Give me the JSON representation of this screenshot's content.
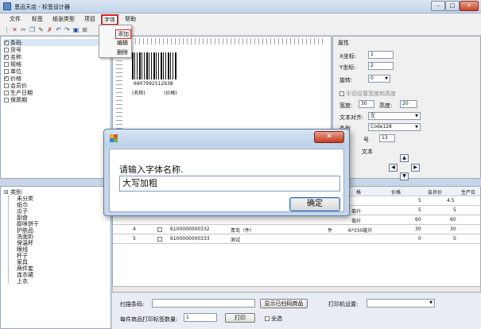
{
  "window": {
    "title": "恩迅天店 - 标签设计器"
  },
  "menu": [
    "文件",
    "标签",
    "纸张类型",
    "项目",
    "字体",
    "帮助"
  ],
  "font_menu": {
    "items": [
      "添加",
      "编辑",
      "删除"
    ]
  },
  "fields": [
    {
      "label": "条码",
      "checked": true
    },
    {
      "label": "货号",
      "checked": false
    },
    {
      "label": "名称",
      "checked": true
    },
    {
      "label": "规格",
      "checked": false
    },
    {
      "label": "单位",
      "checked": false
    },
    {
      "label": "价格",
      "checked": true
    },
    {
      "label": "会员价",
      "checked": false
    },
    {
      "label": "生产日期",
      "checked": false
    },
    {
      "label": "保质期",
      "checked": false
    }
  ],
  "label_preview": {
    "barcode_number": "6907992512938",
    "left_text": "(名称)",
    "right_text": "(价格)"
  },
  "properties": {
    "title": "属性",
    "x_label": "X坐标:",
    "x_value": "1",
    "y_label": "Y坐标:",
    "y_value": "2",
    "rotate_label": "旋转:",
    "rotate_value": "0",
    "manual_size_label": "手动设置宽度和高度",
    "width_label": "宽度:",
    "width_value": "30",
    "height_label": "高度:",
    "height_value": "20",
    "align_label": "文本对齐:",
    "align_value": "左",
    "type_label": "条型",
    "type_value": "Code128",
    "size_label": "号",
    "size_value": "13",
    "text_label": "文本"
  },
  "categories": {
    "root": "类别",
    "items": [
      "未分类",
      "纸巾",
      "瓜子",
      "副食",
      "膨咪饼干",
      "护肤品",
      "洗面奶",
      "保温杯",
      "眼线",
      "杯子",
      "家具",
      "两件套",
      "连衣裙",
      "上衣"
    ]
  },
  "table": {
    "headers": [
      "格",
      "价格",
      "会员价",
      "生产日"
    ],
    "rows": [
      {
        "no": "",
        "code": "",
        "name": "",
        "unit": "",
        "spec": "",
        "price": "5",
        "member": "4.5"
      },
      {
        "no": "",
        "code": "",
        "name": "",
        "unit": "",
        "spec": "毫升",
        "price": "5",
        "member": "5"
      },
      {
        "no": "",
        "code": "",
        "name": "",
        "unit": "",
        "spec": "毫升",
        "price": "60",
        "member": "60"
      },
      {
        "no": "4",
        "code": "6100000000332",
        "name": "青岛（件）",
        "unit": "件",
        "spec": "6*330毫升",
        "price": "30",
        "member": "30"
      },
      {
        "no": "5",
        "code": "6100000000333",
        "name": "测试",
        "unit": "",
        "spec": "",
        "price": "0",
        "member": "0"
      }
    ]
  },
  "bottom": {
    "scan_label": "扫描条码:",
    "show_scanned": "显示已扫码商品",
    "printer_label": "打印机设置:",
    "qty_label": "每件商品打印标签数量:",
    "qty_value": "1",
    "print": "打印",
    "select_all": "全选"
  },
  "dialog": {
    "prompt": "请输入字体名称.",
    "input_value": "大写加粗",
    "ok": "确定",
    "close": "✕"
  }
}
